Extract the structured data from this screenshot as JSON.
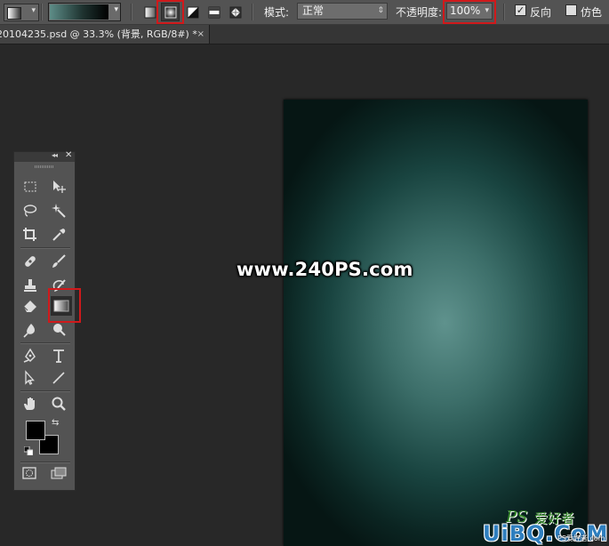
{
  "options_bar": {
    "preset_icon": "gradient-tool-preset-icon",
    "gradient_colors": [
      "#5e8d88",
      "#1f3431",
      "#000000"
    ],
    "gradient_types": [
      {
        "name": "linear-gradient-icon",
        "active": false
      },
      {
        "name": "radial-gradient-icon",
        "active": true
      },
      {
        "name": "angle-gradient-icon",
        "active": false
      },
      {
        "name": "reflected-gradient-icon",
        "active": false
      },
      {
        "name": "diamond-gradient-icon",
        "active": false
      }
    ],
    "mode_label": "模式:",
    "mode_value": "正常",
    "opacity_label": "不透明度:",
    "opacity_value": "100%",
    "reverse_label": "反向",
    "reverse_checked": true,
    "dither_label": "仿色",
    "dither_checked": false,
    "highlight_color": "#d0191b"
  },
  "document_tab": {
    "title": "20104235.psd @ 33.3% (背景, RGB/8#) *",
    "close_glyph": "×"
  },
  "canvas": {
    "gradient_center_color": "#5f928d",
    "gradient_edge_color": "#061614",
    "watermark": "www.240PS.com",
    "logo_ps": "PS",
    "logo_cn": "爱好者",
    "logo_main": "UiBQ.CoM",
    "logo_small": "PS爱好者.com"
  },
  "toolbox": {
    "collapse_glyph": "◂◂",
    "close_glyph": "✕",
    "active_tool": "gradient-tool",
    "foreground_color": "#000000",
    "background_color": "#000000"
  }
}
